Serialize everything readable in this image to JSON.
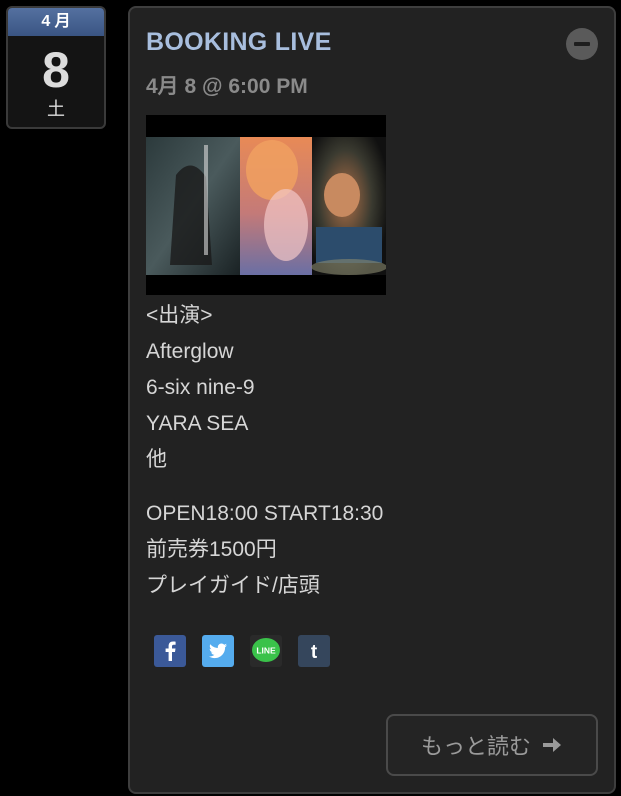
{
  "date_badge": {
    "month": "4 月",
    "day": "8",
    "weekday": "土"
  },
  "event": {
    "title": "BOOKING LIVE",
    "datetime": "4月 8 @ 6:00 PM",
    "lineup_heading": "<出演>",
    "performers": [
      "Afterglow",
      "6-six nine-9",
      "YARA SEA",
      "他"
    ],
    "info_lines": [
      "OPEN18:00 START18:30",
      "前売券1500円",
      "プレイガイド/店頭"
    ]
  },
  "share": {
    "icons": [
      "facebook-icon",
      "twitter-icon",
      "line-icon",
      "tumblr-icon"
    ],
    "line_label": "LINE",
    "tumblr_label": "t"
  },
  "read_more": {
    "label": "もっと読む"
  },
  "colors": {
    "title": "#a8bede",
    "month_header": "#3a5583",
    "facebook": "#3b5998",
    "twitter": "#55acee",
    "line": "#3ac24a",
    "tumblr": "#35465c"
  }
}
